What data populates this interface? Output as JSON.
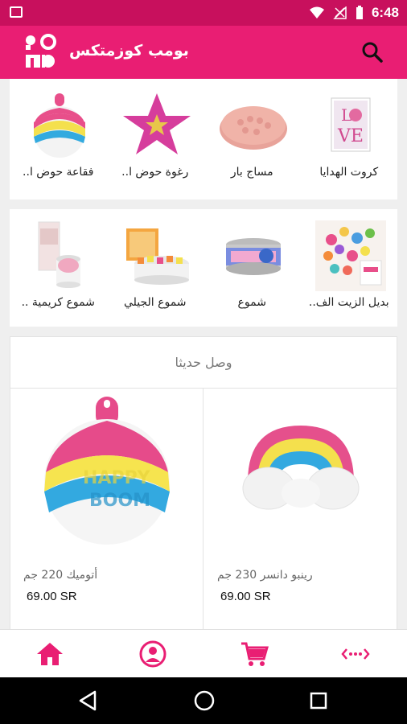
{
  "status_bar": {
    "time": "6:48",
    "notification_icon": "image-icon",
    "icons": [
      "wifi-icon",
      "signal-icon",
      "battery-icon"
    ]
  },
  "app_bar": {
    "title": "بومب كوزمتكس",
    "logo_text": "BOMB",
    "search_icon": "search-icon"
  },
  "categories_row1": [
    {
      "label": "كروت الهدايا",
      "icon": "gift-card-love-image"
    },
    {
      "label": "مساج بار",
      "icon": "massage-bar-image"
    },
    {
      "label": "رغوة حوض ا..",
      "icon": "bath-foam-star-image"
    },
    {
      "label": "فقاعة حوض ا..",
      "icon": "bath-bubble-image"
    }
  ],
  "categories_row2": [
    {
      "label": "بديل الزيت الف..",
      "icon": "oil-alternative-image"
    },
    {
      "label": "شموع",
      "icon": "candles-image"
    },
    {
      "label": "شموع الجيلي",
      "icon": "jelly-candles-image"
    },
    {
      "label": "شموع كريمية ..",
      "icon": "creamy-candles-image"
    }
  ],
  "new_arrivals": {
    "title": "وصل حديثا",
    "products": [
      {
        "name": "رينبو دانسر 230 جم",
        "price": "69.00 SR",
        "image": "rainbow-soap-image"
      },
      {
        "name": "أتوميك 220 جم",
        "price": "69.00 SR",
        "image": "atomic-bath-bomb-image"
      }
    ]
  },
  "bottom_nav": [
    "home-icon",
    "profile-icon",
    "cart-icon",
    "more-icon"
  ],
  "system_nav": [
    "back-icon",
    "home-circle-icon",
    "recents-icon"
  ],
  "colors": {
    "primary": "#e91e73",
    "status": "#c8105d"
  }
}
